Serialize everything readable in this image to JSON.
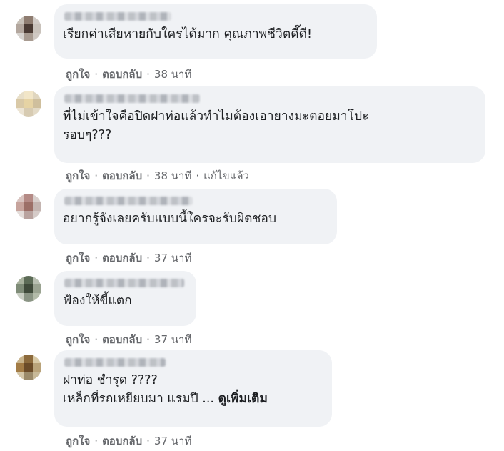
{
  "comments": [
    {
      "text": "เรียกค่าเสียหายกับใครได้มาก คุณภาพชีวิตดี๊ดี!",
      "like": "ถูกใจ",
      "reply": "ตอบกลับ",
      "time": "38 นาที",
      "edited": "",
      "avatar_colors": [
        "#c7c0b7",
        "#8e7c70",
        "#d1cbc6",
        "#b3a79e",
        "#4a3a33",
        "#c9c2bb",
        "#d6d2ce",
        "#a89b91",
        "#cfc8c2"
      ]
    },
    {
      "text": "ที่ไม่เข้าใจคือปิดฝาท่อแล้วทำไมต้องเอายางมะตอยมาโปะ\nรอบๆ???",
      "like": "ถูกใจ",
      "reply": "ตอบกลับ",
      "time": "38 นาที",
      "edited": "แก้ไขแล้ว",
      "avatar_colors": [
        "#e8dfc9",
        "#f2e6c8",
        "#e0d6bf",
        "#d9c9a7",
        "#e6d3a4",
        "#cfbf9d",
        "#ece4d4",
        "#d7cbb2",
        "#e3dac6"
      ]
    },
    {
      "text": "อยากรู้จังเลยครับแบบนี้ใครจะรับผิดชอบ",
      "like": "ถูกใจ",
      "reply": "ตอบกลับ",
      "time": "37 นาที",
      "edited": "",
      "avatar_colors": [
        "#d9c4c0",
        "#b48a85",
        "#d8cfcc",
        "#c7a49d",
        "#9c6f67",
        "#c4b5b1",
        "#e3dcd9",
        "#b9a39f",
        "#d5cbc8"
      ]
    },
    {
      "text": "ฟ้องให้ขี้แตก",
      "like": "ถูกใจ",
      "reply": "ตอบกลับ",
      "time": "37 นาที",
      "edited": "",
      "avatar_colors": [
        "#a9b29e",
        "#5c6b56",
        "#b8bfb1",
        "#7f8c78",
        "#3f4a3a",
        "#9aa391",
        "#c8cdc2",
        "#8a9484",
        "#b3bba9"
      ]
    },
    {
      "text": "ฝาท่อ ชำรุด ????\nเหล็กที่รถเหยียบมา แรมปี ...",
      "more": "ดูเพิ่มเติม",
      "like": "ถูกใจ",
      "reply": "ตอบกลับ",
      "time": "37 นาที",
      "edited": "",
      "avatar_colors": [
        "#c9b48c",
        "#8c6a3c",
        "#d8c9a6",
        "#a37c46",
        "#6b4b28",
        "#b9a37a",
        "#d4c6a8",
        "#9b8a6a",
        "#c8b998"
      ]
    }
  ]
}
